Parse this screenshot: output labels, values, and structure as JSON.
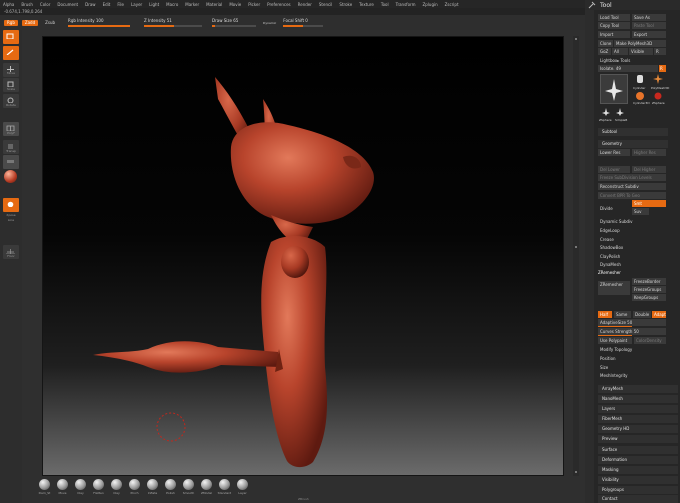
{
  "menubar": {
    "items": [
      "Alpha",
      "Brush",
      "Color",
      "Document",
      "Draw",
      "Edit",
      "File",
      "Layer",
      "Light",
      "Macro",
      "Marker",
      "Material",
      "Movie",
      "Picker",
      "Preferences",
      "Render",
      "Stencil",
      "Stroke",
      "Texture",
      "Tool",
      "Transform",
      "Zplugin",
      "Zscript"
    ]
  },
  "status": {
    "coords": "-0.674,1.798,0.264"
  },
  "toolbar": {
    "rgb": "Rgb",
    "zadd": "Zadd",
    "zsub": "Zsub",
    "rgb_intensity": "Rgb Intensity 100",
    "z_intensity": "Z Intensity 51",
    "draw_size": "Draw Size 65",
    "dynamic": "Dynamic",
    "focal_shift": "Focal Shift 0",
    "rgb_intensity_level": 1.0,
    "z_intensity_level": 0.51,
    "draw_size_level": 0.07,
    "focal_shift_level": 0.5
  },
  "leftshelf": {
    "caps": [
      "Edit",
      "Draw",
      "Move",
      "Scale",
      "Rotate",
      "PolyF",
      "Transp",
      "Solo",
      "Xpose",
      "Line",
      "Fill",
      "Floor"
    ]
  },
  "brushes": [
    {
      "label": "Dam_St"
    },
    {
      "label": "Move"
    },
    {
      "label": "Clay"
    },
    {
      "label": "Flatten"
    },
    {
      "label": "Clay"
    },
    {
      "label": "Pinch"
    },
    {
      "label": "Inflate"
    },
    {
      "label": "Polish"
    },
    {
      "label": "Smooth"
    },
    {
      "label": "ZModel"
    },
    {
      "label": "Standard"
    },
    {
      "label": "Layer"
    }
  ],
  "brand": "ZBrush",
  "rightpanel": {
    "title": "Tool",
    "row1": [
      "Load Tool",
      "Save As"
    ],
    "row2": [
      "Copy Tool",
      "Paste Tool"
    ],
    "row3": [
      "Import",
      "Export"
    ],
    "row4": [
      "Clone",
      "Make PolyMesh3D"
    ],
    "row5": [
      "GoZ",
      "All",
      "Visible",
      "R"
    ],
    "lightbox": "Lightbox▸ Tools",
    "tool_name": "Isolate. 49",
    "tool_labels": [
      "Cylinder",
      "PolyMesh3D",
      "Cylinder3D",
      "ZSphere",
      "ZSphere",
      "SimpleB"
    ],
    "subtool": "Subtool",
    "geometry": "Geometry",
    "geo_row1": [
      "Lower Res",
      "Higher Res"
    ],
    "geo_row2": [
      "Del Lower",
      "Del Higher"
    ],
    "geo_row3": [
      "Freeze SubDivision Levels"
    ],
    "reconstruct": "Reconstruct Subdiv",
    "convert_bpr": "Convert BPR To Geo",
    "smt": "Smt",
    "suv": "Suv",
    "divide": "Divide",
    "edgeloop": "EdgeLoop",
    "crease": "Crease",
    "shadowbox": "ShadowBox",
    "claypolish": "ClayPolish",
    "dynamesh": "DynaMesh",
    "zremesher": "ZRemesher",
    "freeze_borders": "FreezeBorder",
    "freeze_groups": "FreezeGroups",
    "keep_groups": "KeepGroups",
    "zremesher2": "ZRemesher",
    "half": "Half",
    "same": "Same",
    "double": "Double",
    "adapt": "Adapt",
    "adaptive_size": "AdaptiveSize 50",
    "adaptive_size_level": 0.5,
    "curves_strength": "Curves Strength 50",
    "curves_strength_level": 0.5,
    "use_polypaint": "Use Polypaint",
    "colorDensity": "ColorDensity",
    "modify_topology": "Modify Topology",
    "position": "Position",
    "size": "Size",
    "mesh_integrity": "MeshIntegrity",
    "sections": [
      "ArrayMesh",
      "NanoMesh",
      "Layers",
      "FiberMesh",
      "Geometry HD",
      "Preview",
      "Surface",
      "Deformation",
      "Masking",
      "Visibility",
      "Polygroups",
      "Contact"
    ]
  },
  "colors": {
    "accent": "#e66a12",
    "model": "#b8442c",
    "brush_cursor": "#c0281e"
  }
}
